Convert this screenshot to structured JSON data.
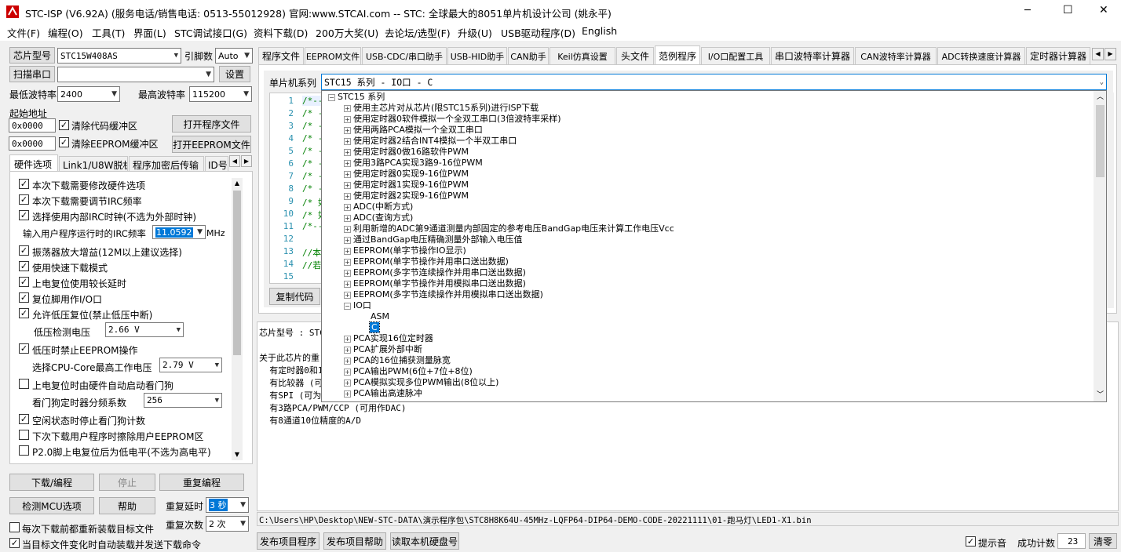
{
  "window": {
    "title": "STC-ISP (V6.92A) (服务电话/销售电话: 0513-55012928) 官网:www.STCAI.com  -- STC: 全球最大的8051单片机设计公司 (姚永平)",
    "minimize": "─",
    "maximize": "☐",
    "close": "✕"
  },
  "menu": [
    "文件(F)",
    "编程(O)",
    "工具(T)",
    "界面(L)",
    "STC调试接口(G)",
    "资料下载(D)",
    "200万大奖(U)",
    "去论坛/选型(F)",
    "升级(U)",
    "USB驱动程序(D)",
    "English"
  ],
  "left": {
    "chip_label": "芯片型号",
    "chip_value": "STC15W408AS",
    "pin_label": "引脚数",
    "pin_value": "Auto",
    "scan_label": "扫描串口",
    "settings_label": "设置",
    "min_baud_label": "最低波特率",
    "min_baud_value": "2400",
    "max_baud_label": "最高波特率",
    "max_baud_value": "115200",
    "start_addr_label": "起始地址",
    "addr1": "0x0000",
    "clear_code": "清除代码缓冲区",
    "open_prog": "打开程序文件",
    "addr2": "0x0000",
    "clear_eeprom": "清除EEPROM缓冲区",
    "open_eeprom": "打开EEPROM文件",
    "tabs": [
      "硬件选项",
      "Link1/U8W脱机",
      "程序加密后传输",
      "ID号"
    ],
    "options": [
      {
        "text": "本次下载需要修改硬件选项",
        "checked": true
      },
      {
        "text": "本次下载需要调节IRC频率",
        "checked": true
      },
      {
        "text": "选择使用内部IRC时钟(不选为外部时钟)",
        "checked": true
      },
      {
        "text": "输入用户程序运行时的IRC频率",
        "value": "11.0592",
        "unit": "MHz"
      },
      {
        "text": "振荡器放大增益(12M以上建议选择)",
        "checked": true
      },
      {
        "text": "使用快速下载模式",
        "checked": true
      },
      {
        "text": "上电复位使用较长延时",
        "checked": true
      },
      {
        "text": "复位脚用作I/O口",
        "checked": true
      },
      {
        "text": "允许低压复位(禁止低压中断)",
        "checked": true
      },
      {
        "text": "低压检测电压",
        "value": "2.66 V"
      },
      {
        "text": "低压时禁止EEPROM操作",
        "checked": true
      },
      {
        "text": "选择CPU-Core最高工作电压",
        "value": "2.79 V"
      },
      {
        "text": "上电复位时由硬件自动启动看门狗",
        "checked": false
      },
      {
        "text": "看门狗定时器分频系数",
        "value": "256"
      },
      {
        "text": "空闲状态时停止看门狗计数",
        "checked": true
      },
      {
        "text": "下次下载用户程序时擦除用户EEPROM区",
        "checked": false
      },
      {
        "text": "P2.0脚上电复位后为低电平(不选为高电平)",
        "checked": false
      }
    ],
    "download": "下载/编程",
    "stop": "停止",
    "reprogram": "重复编程",
    "detect": "检测MCU选项",
    "help": "帮助",
    "repeat_delay_label": "重复延时",
    "repeat_delay_value": "3 秒",
    "reload_label": "每次下载前都重新装载目标文件",
    "repeat_count_label": "重复次数",
    "repeat_count_value": "2 次",
    "auto_reload_label": "当目标文件变化时自动装载并发送下载命令"
  },
  "right": {
    "tabs": [
      "程序文件",
      "EEPROM文件",
      "USB-CDC/串口助手",
      "USB-HID助手",
      "CAN助手",
      "Keil仿真设置",
      "头文件",
      "范例程序",
      "I/O口配置工具",
      "串口波特率计算器",
      "CAN波特率计算器",
      "ADC转换速度计算器",
      "定时器计算器"
    ],
    "active_tab": "范例程序",
    "series_label": "单片机系列",
    "series_value": "STC15 系列 - IO口 - C",
    "line_numbers": [
      "1",
      "2",
      "3",
      "4",
      "5",
      "6",
      "7",
      "8",
      "9",
      "10",
      "11",
      "12",
      "13",
      "14",
      "15"
    ],
    "code_lines": [
      "/*---",
      "/* -",
      "/* -",
      "/* -",
      "/* -",
      "/* -",
      "/* -",
      "/* -",
      "/* 如",
      "/* 如",
      "/*--",
      "",
      "//本",
      "//若",
      ""
    ],
    "copy_code": "复制代码",
    "tree": [
      {
        "level": 0,
        "text": "STC15 系列",
        "node": "minus"
      },
      {
        "level": 1,
        "text": "使用主芯片对从芯片(限STC15系列)进行ISP下载",
        "node": "plus"
      },
      {
        "level": 1,
        "text": "使用定时器0软件模拟一个全双工串口(3倍波特率采样)",
        "node": "plus"
      },
      {
        "level": 1,
        "text": "使用两路PCA模拟一个全双工串口",
        "node": "plus"
      },
      {
        "level": 1,
        "text": "使用定时器2结合INT4模拟一个半双工串口",
        "node": "plus"
      },
      {
        "level": 1,
        "text": "使用定时器0做16路软件PWM",
        "node": "plus"
      },
      {
        "level": 1,
        "text": "使用3路PCA实现3路9-16位PWM",
        "node": "plus"
      },
      {
        "level": 1,
        "text": "使用定时器0实现9-16位PWM",
        "node": "plus"
      },
      {
        "level": 1,
        "text": "使用定时器1实现9-16位PWM",
        "node": "plus"
      },
      {
        "level": 1,
        "text": "使用定时器2实现9-16位PWM",
        "node": "plus"
      },
      {
        "level": 1,
        "text": "ADC(中断方式)",
        "node": "plus"
      },
      {
        "level": 1,
        "text": "ADC(查询方式)",
        "node": "plus"
      },
      {
        "level": 1,
        "text": "利用新增的ADC第9通道测量内部固定的参考电压BandGap电压来计算工作电压Vcc",
        "node": "plus"
      },
      {
        "level": 1,
        "text": "通过BandGap电压精确测量外部输入电压值",
        "node": "plus"
      },
      {
        "level": 1,
        "text": "EEPROM(单字节操作IO显示)",
        "node": "plus"
      },
      {
        "level": 1,
        "text": "EEPROM(单字节操作并用串口送出数据)",
        "node": "plus"
      },
      {
        "level": 1,
        "text": "EEPROM(多字节连续操作并用串口送出数据)",
        "node": "plus"
      },
      {
        "level": 1,
        "text": "EEPROM(单字节操作并用模拟串口送出数据)",
        "node": "plus"
      },
      {
        "level": 1,
        "text": "EEPROM(多字节连续操作并用模拟串口送出数据)",
        "node": "plus"
      },
      {
        "level": 1,
        "text": "IO口",
        "node": "minus"
      },
      {
        "level": 2,
        "text": "ASM",
        "node": "none"
      },
      {
        "level": 2,
        "text": "C",
        "node": "none",
        "selected": true
      },
      {
        "level": 1,
        "text": "PCA实现16位定时器",
        "node": "plus"
      },
      {
        "level": 1,
        "text": "PCA扩展外部中断",
        "node": "plus"
      },
      {
        "level": 1,
        "text": "PCA的16位捕获测量脉宽",
        "node": "plus"
      },
      {
        "level": 1,
        "text": "PCA输出PWM(6位+7位+8位)",
        "node": "plus"
      },
      {
        "level": 1,
        "text": "PCA模拟实现多位PWM输出(8位以上)",
        "node": "plus"
      },
      {
        "level": 1,
        "text": "PCA输出高速脉冲",
        "node": "plus"
      }
    ],
    "info_lines": [
      "芯片型号 : STC",
      "",
      "关于此芯片的重",
      "  有定时器0和1",
      "  有比较器 (可",
      "  有SPI (可为主",
      "  有3路PCA/PWM/CCP (可用作DAC)",
      "  有8通道10位精度的A/D"
    ],
    "path": "C:\\Users\\HP\\Desktop\\NEW-STC-DATA\\演示程序包\\STC8H8K64U-45MHz-LQFP64-DIP64-DEMO-CODE-20221111\\01-跑马灯\\LED1-X1.bin",
    "publish_project": "发布项目程序",
    "publish_help": "发布项目帮助",
    "read_disk": "读取本机硬盘号",
    "sound_label": "提示音",
    "success_label": "成功计数",
    "success_value": "23",
    "clear": "清零"
  }
}
